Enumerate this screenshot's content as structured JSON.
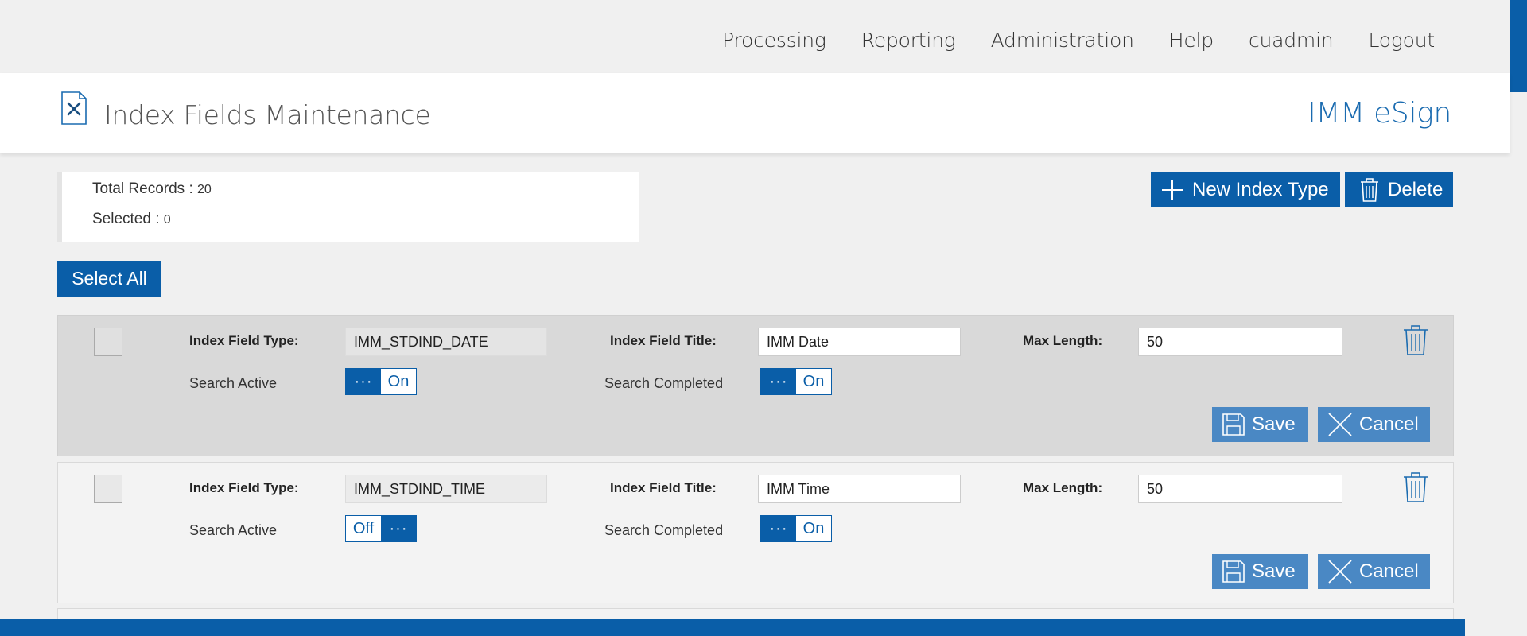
{
  "nav": [
    "Processing",
    "Reporting",
    "Administration",
    "Help",
    "cuadmin",
    "Logout"
  ],
  "header": {
    "title": "Index Fields Maintenance",
    "brand": "IMM eSign",
    "icon": "tools-document-icon"
  },
  "summary": {
    "total_label": "Total Records : ",
    "total_value": "20",
    "selected_label": "Selected : ",
    "selected_value": "0"
  },
  "actions": {
    "new_index_type": "New Index Type",
    "delete": "Delete",
    "select_all": "Select All"
  },
  "labels": {
    "type": "Index Field Type:",
    "title": "Index Field Title:",
    "max": "Max Length:",
    "search_active": "Search Active",
    "search_completed": "Search Completed",
    "save": "Save",
    "cancel": "Cancel",
    "knob": "···"
  },
  "rows": [
    {
      "type": "IMM_STDIND_DATE",
      "title": "IMM Date",
      "max_length": "50",
      "search_active": "On",
      "search_completed": "On"
    },
    {
      "type": "IMM_STDIND_TIME",
      "title": "IMM Time",
      "max_length": "50",
      "search_active": "Off",
      "search_completed": "On"
    }
  ],
  "colors": {
    "primary": "#0a5ea8",
    "light_button": "#4a88c4",
    "brand": "#1a6bb0"
  }
}
